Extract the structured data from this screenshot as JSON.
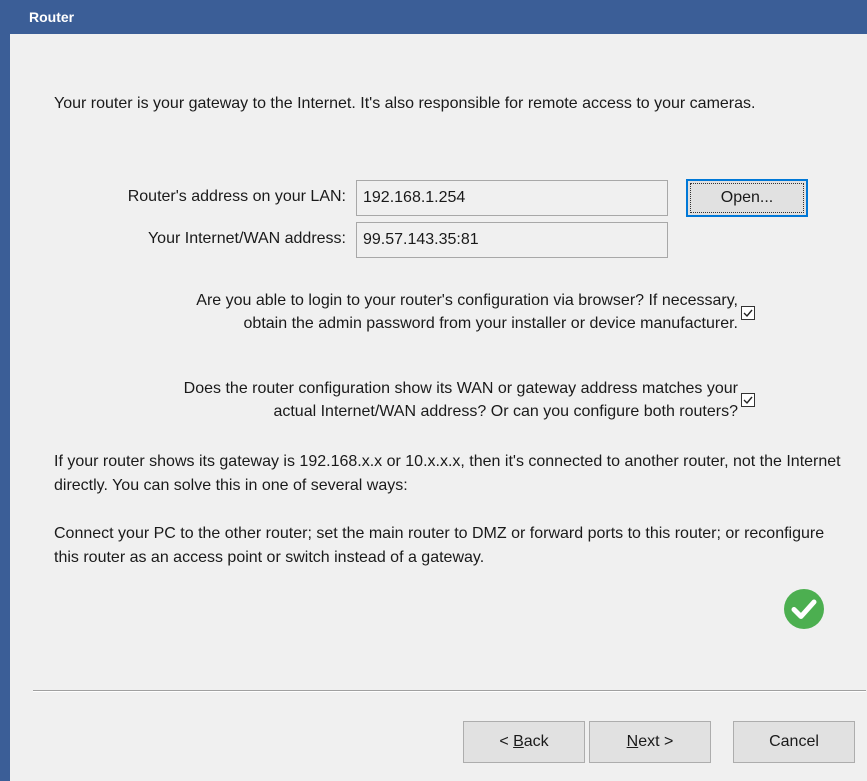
{
  "window": {
    "title": "Router"
  },
  "intro": "Your router is your gateway to the Internet.  It's also responsible for remote access to your cameras.",
  "fields": {
    "lan_label": "Router's address on your LAN:",
    "lan_value": "192.168.1.254",
    "wan_label": "Your Internet/WAN address:",
    "wan_value": "99.57.143.35:81"
  },
  "open_button": "Open...",
  "questions": [
    {
      "line1": "Are you able to login to your router's configuration via browser?  If necessary,",
      "line2": "obtain the admin password from your installer or device manufacturer.",
      "checked": true
    },
    {
      "line1": "Does the router configuration show its WAN or gateway address matches your",
      "line2": "actual Internet/WAN address?  Or can you configure both routers?",
      "checked": true
    }
  ],
  "info1": "If your router shows its gateway is 192.168.x.x or 10.x.x.x, then it's connected to another router, not the Internet directly.  You can solve this in one of several ways:",
  "info2": "Connect your PC to the other router; set the main router to DMZ or forward ports to this router; or reconfigure this router as an access point or switch instead of a gateway.",
  "status_icon": "check-circle-icon",
  "colors": {
    "titlebar": "#3b5e97",
    "success": "#4caf50"
  },
  "buttons": {
    "back": {
      "prefix": "< ",
      "accel": "B",
      "rest": "ack"
    },
    "next": {
      "accel": "N",
      "rest": "ext >"
    },
    "cancel": "Cancel"
  }
}
